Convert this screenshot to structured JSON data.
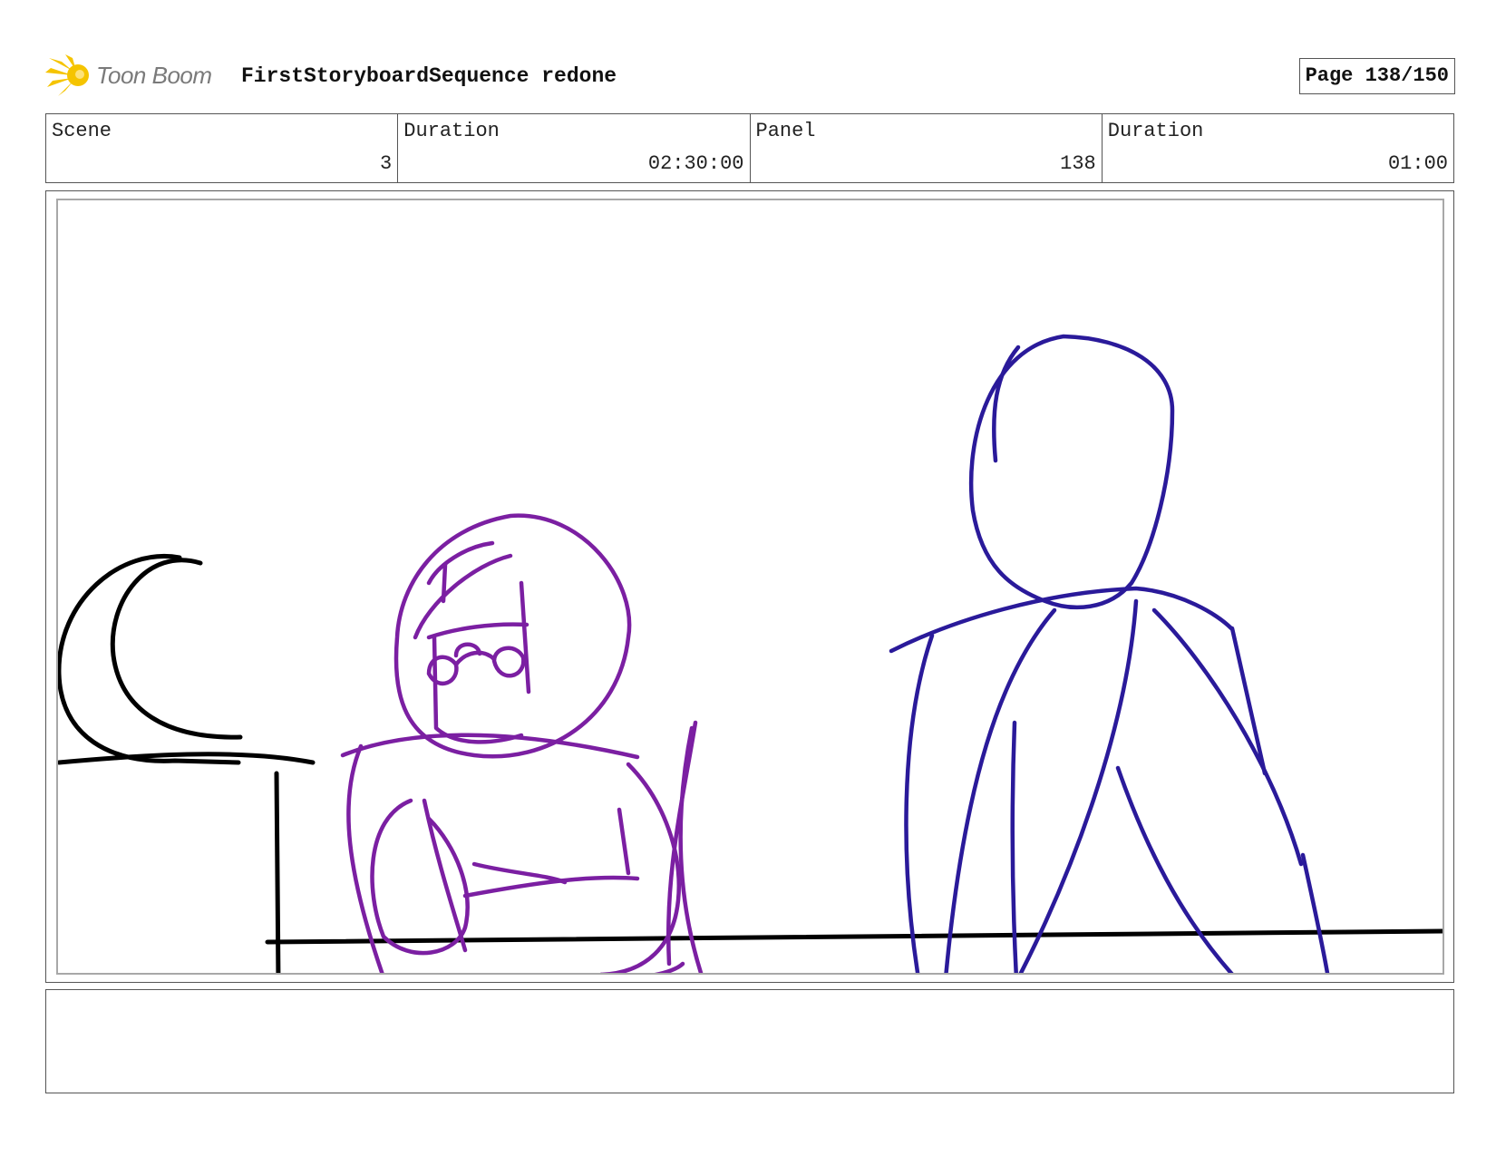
{
  "header": {
    "logo_text": "Toon Boom",
    "project_title": "FirstStoryboardSequence redone",
    "page_label": "Page 138/150"
  },
  "info": {
    "scene_label": "Scene",
    "scene_value": "3",
    "scene_duration_label": "Duration",
    "scene_duration_value": "02:30:00",
    "panel_label": "Panel",
    "panel_value": "138",
    "panel_duration_label": "Duration",
    "panel_duration_value": "01:00"
  },
  "colors": {
    "logo_yellow": "#f5c400",
    "sketch_black": "#000000",
    "sketch_purple": "#7b1fa2",
    "sketch_blue": "#2a1a9a"
  },
  "panel": {
    "icons": [
      "toon-boom-logo-icon"
    ]
  },
  "notes": {
    "text": ""
  }
}
